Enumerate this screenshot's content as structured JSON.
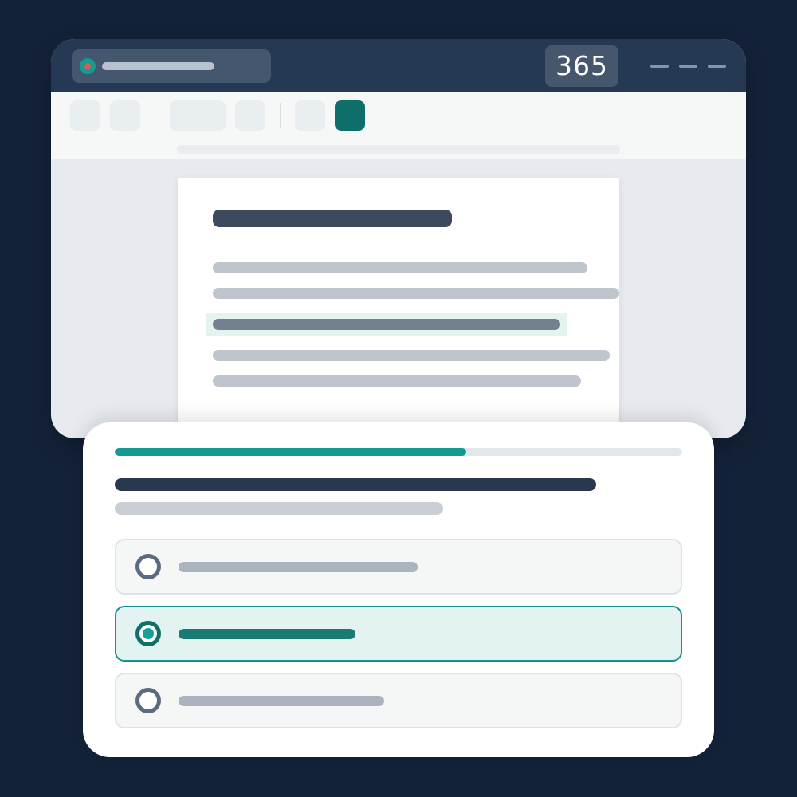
{
  "window": {
    "badge": "365",
    "colors": {
      "titlebar": "#263954",
      "accent": "#0e6f6a",
      "recording": "#e0584f"
    },
    "icons": [
      "record-indicator-icon",
      "minimize-icon",
      "maximize-icon",
      "close-icon"
    ]
  },
  "quiz": {
    "progress": 0.62,
    "selected_option": 2,
    "option_count": 3,
    "colors": {
      "accent": "#149b91",
      "selected_bg": "#e3f3f1"
    },
    "icons": [
      "radio-icon"
    ]
  }
}
